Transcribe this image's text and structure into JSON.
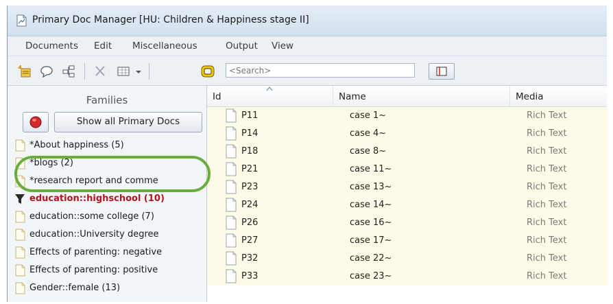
{
  "window": {
    "title": "Primary Doc Manager [HU: Children & Happiness stage II]"
  },
  "menu": [
    "Documents",
    "Edit",
    "Miscellaneous",
    "Output",
    "View"
  ],
  "toolbar": {
    "search_placeholder": "<Search>"
  },
  "families": {
    "header": "Families",
    "show_all_label": "Show all Primary Docs",
    "items": [
      {
        "label": "*About happiness (5)",
        "selected": false
      },
      {
        "label": "*blogs (2)",
        "selected": false
      },
      {
        "label": "*research report and comme",
        "selected": false
      },
      {
        "label": "education::highschool (10)",
        "selected": true
      },
      {
        "label": "education::some college (7)",
        "selected": false
      },
      {
        "label": "education::University degree",
        "selected": false
      },
      {
        "label": "Effects of parenting: negative",
        "selected": false
      },
      {
        "label": "Effects of parenting: positive",
        "selected": false
      },
      {
        "label": "Gender::female (13)",
        "selected": false
      }
    ]
  },
  "table": {
    "columns": [
      "Id",
      "Name",
      "Media"
    ],
    "rows": [
      {
        "id": "P11",
        "name": "case 1~",
        "media": "Rich Text"
      },
      {
        "id": "P14",
        "name": "case 4~",
        "media": "Rich Text"
      },
      {
        "id": "P18",
        "name": "case 8~",
        "media": "Rich Text"
      },
      {
        "id": "P21",
        "name": "case 11~",
        "media": "Rich Text"
      },
      {
        "id": "P23",
        "name": "case 13~",
        "media": "Rich Text"
      },
      {
        "id": "P24",
        "name": "case 14~",
        "media": "Rich Text"
      },
      {
        "id": "P26",
        "name": "case 16~",
        "media": "Rich Text"
      },
      {
        "id": "P27",
        "name": "case 17~",
        "media": "Rich Text"
      },
      {
        "id": "P32",
        "name": "case 22~",
        "media": "Rich Text"
      },
      {
        "id": "P33",
        "name": "case 23~",
        "media": "Rich Text"
      }
    ]
  },
  "colors": {
    "selected_family": "#b5121b",
    "callout_outline": "#6aad3c",
    "row_background": "#fbfbe7"
  }
}
